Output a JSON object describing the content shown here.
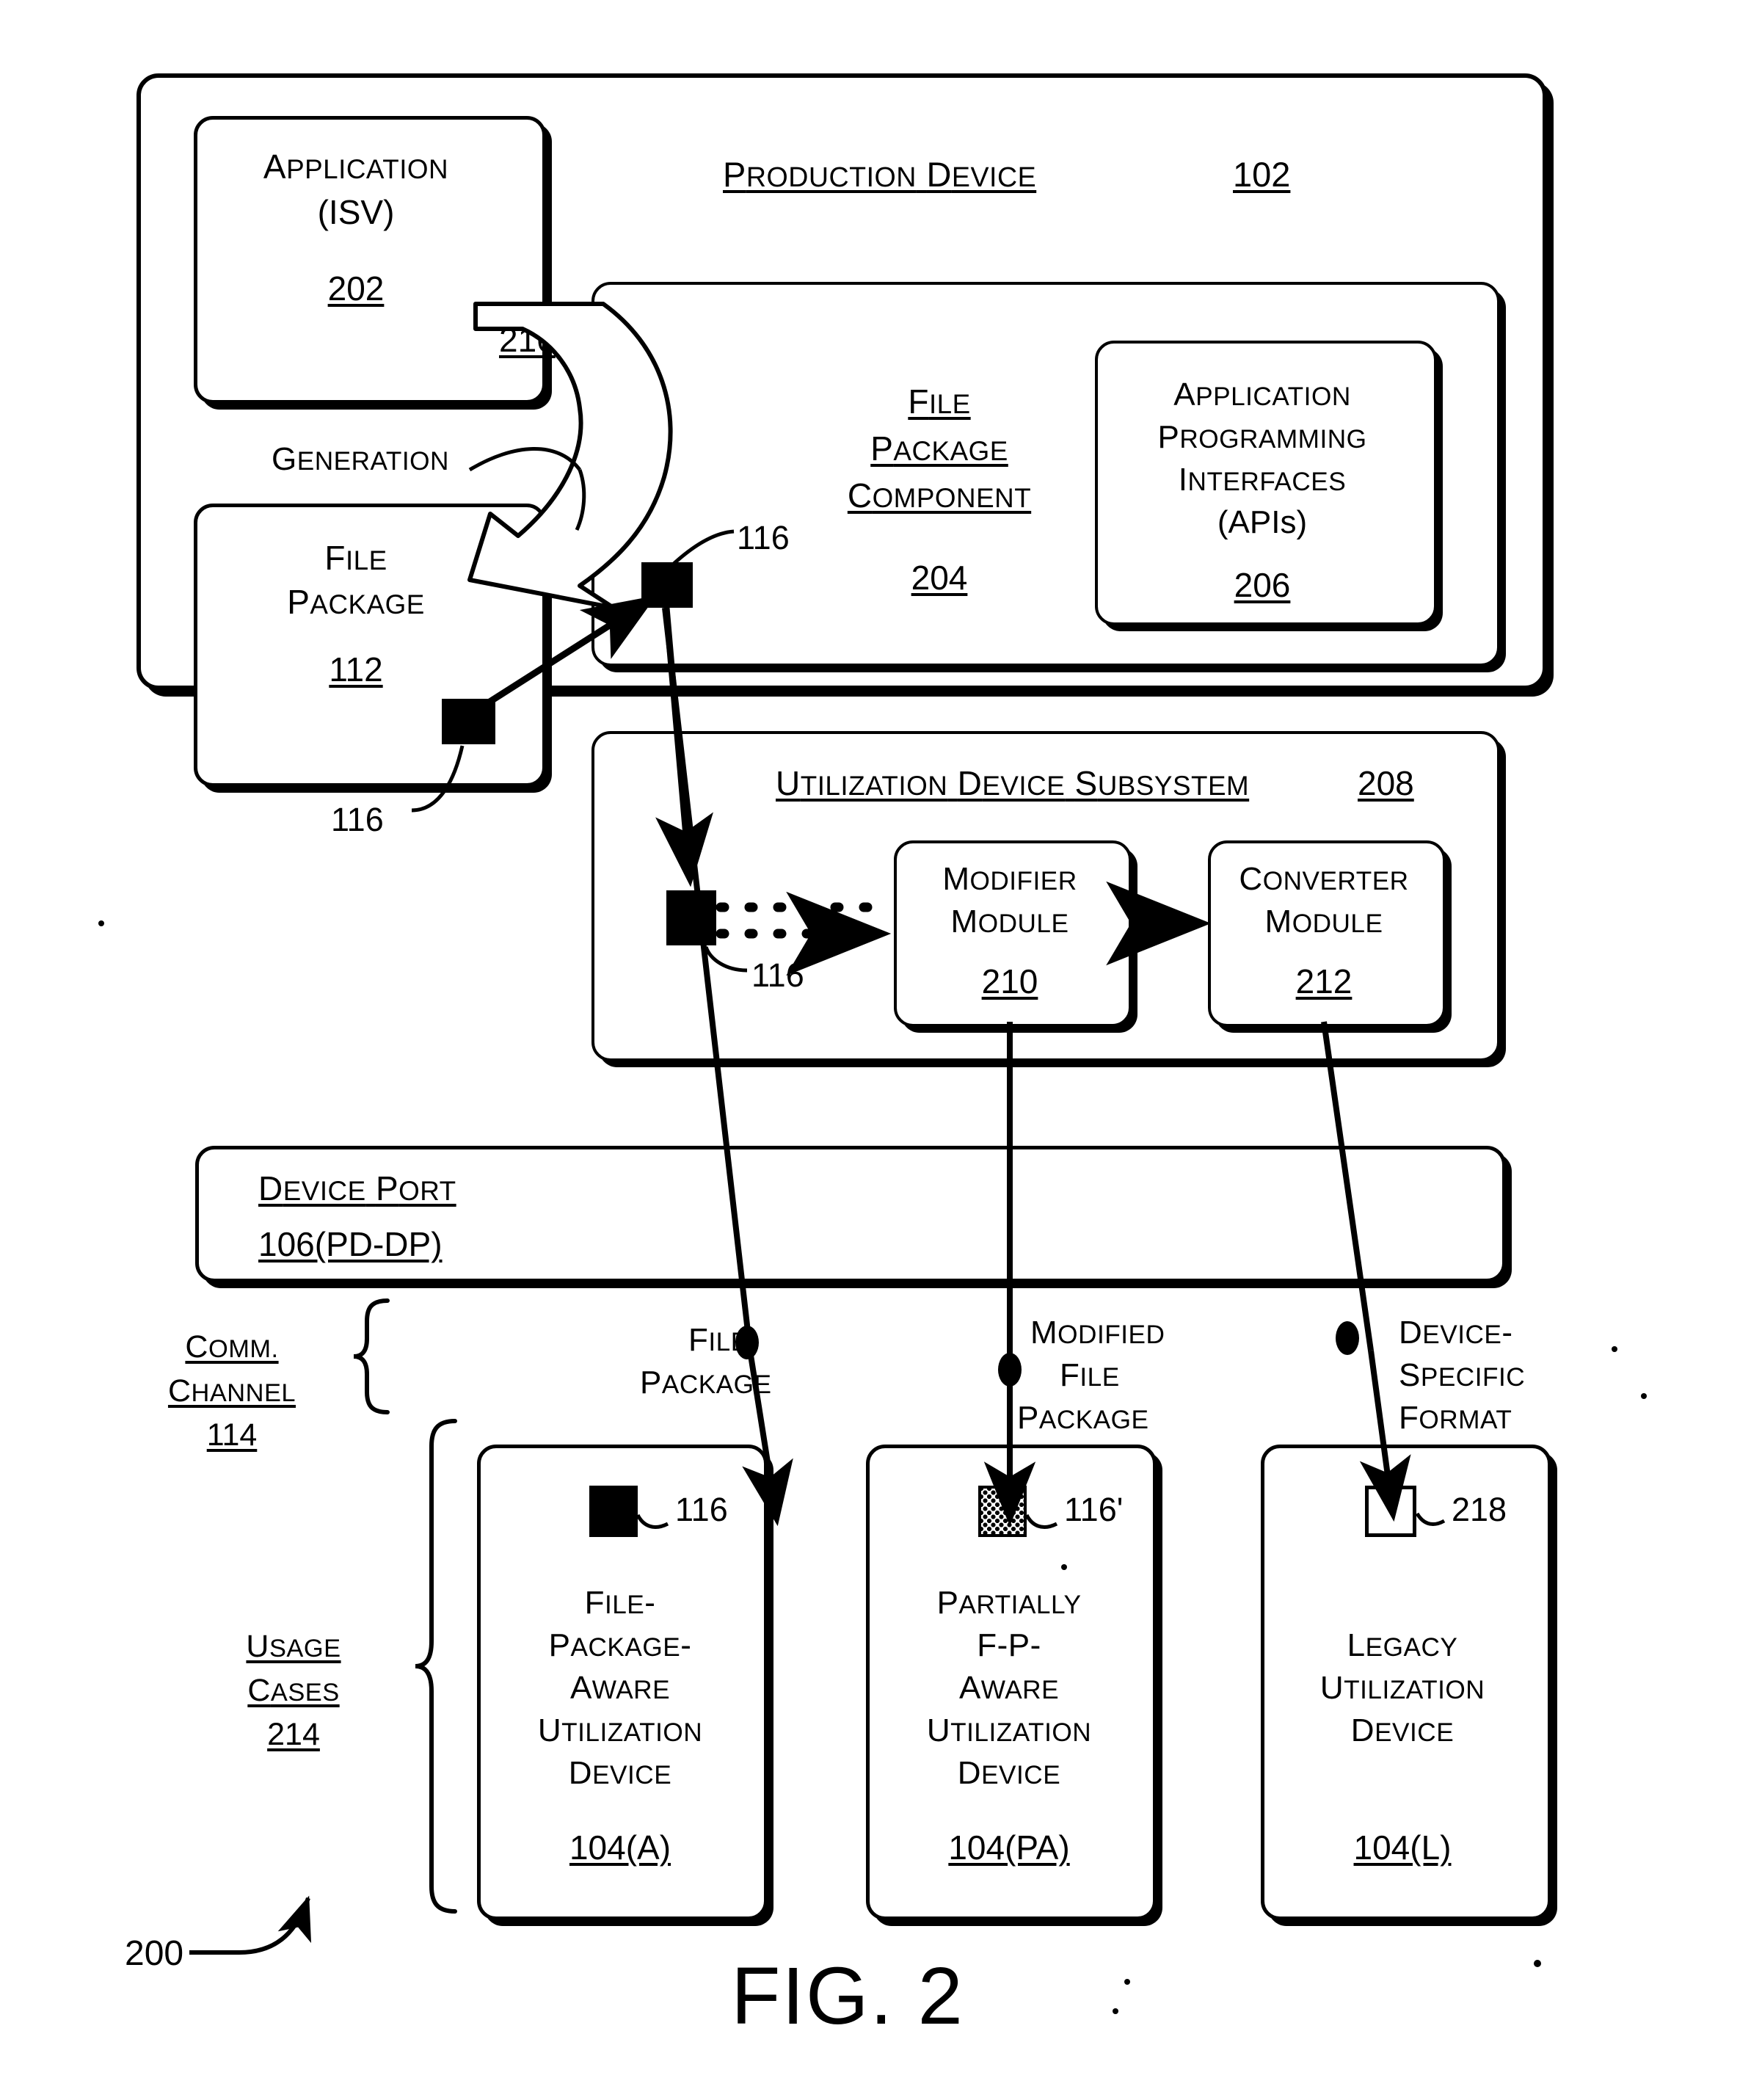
{
  "figure": {
    "caption": "FIG. 2",
    "system_ref": "200"
  },
  "production_device": {
    "title": "Production Device",
    "ref": "102",
    "application": {
      "line1": "Application",
      "line2": "(ISV)",
      "ref": "202"
    },
    "generation": {
      "label": "Generation",
      "ref": "216"
    },
    "file_package": {
      "line1": "File",
      "line2": "Package",
      "ref": "112",
      "marker_ref": "116"
    },
    "file_package_component": {
      "line1": "File",
      "line2": "Package",
      "line3": "Component",
      "ref": "204",
      "marker_ref": "116"
    },
    "apis": {
      "line1": "Application",
      "line2": "Programming",
      "line3": "Interfaces",
      "line4": "(APIs)",
      "ref": "206"
    },
    "utilization_subsystem": {
      "title": "Utilization Device Subsystem",
      "ref": "208",
      "marker_ref": "116",
      "modifier": {
        "line1": "Modifier",
        "line2": "Module",
        "ref": "210"
      },
      "converter": {
        "line1": "Converter",
        "line2": "Module",
        "ref": "212"
      }
    },
    "device_port": {
      "title": "Device Port",
      "ref": "106(PD-DP)"
    }
  },
  "comm_channel": {
    "line1": "Comm.",
    "line2": "Channel",
    "ref": "114"
  },
  "usage_cases": {
    "line1": "Usage",
    "line2": "Cases",
    "ref": "214"
  },
  "flows": [
    {
      "label_lines": [
        "File",
        "Package"
      ],
      "marker_ref": "116",
      "marker_style": "solid"
    },
    {
      "label_lines": [
        "Modified",
        "File",
        "Package"
      ],
      "marker_ref": "116'",
      "marker_style": "hatched"
    },
    {
      "label_lines": [
        "Device-",
        "Specific",
        "Format"
      ],
      "marker_ref": "218",
      "marker_style": "open"
    }
  ],
  "utilization_devices": [
    {
      "lines": [
        "File-",
        "Package-",
        "Aware",
        "Utilization",
        "Device"
      ],
      "ref": "104(A)"
    },
    {
      "lines": [
        "Partially",
        "F-P-",
        "Aware",
        "Utilization",
        "Device"
      ],
      "ref": "104(PA)"
    },
    {
      "lines": [
        "Legacy",
        "Utilization",
        "Device"
      ],
      "ref": "104(L)"
    }
  ],
  "colors": {
    "ink": "#000000",
    "paper": "#ffffff"
  }
}
